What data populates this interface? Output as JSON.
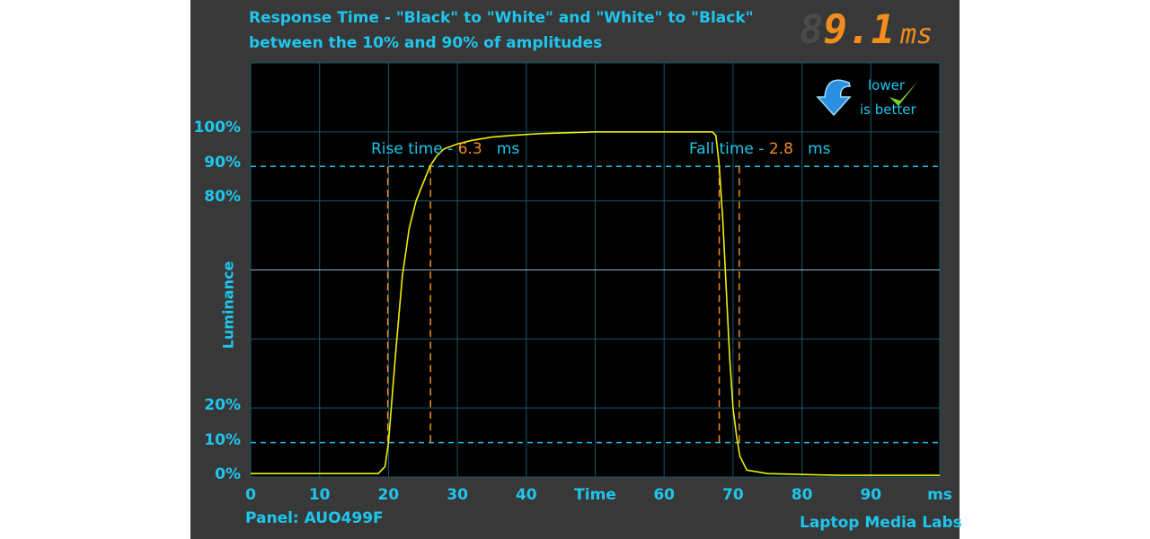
{
  "title_line1": "Response Time - \"Black\" to \"White\" and \"White\" to \"Black\"",
  "title_line2": "between the 10% and 90% of amplitudes",
  "readout": {
    "value": "9.1",
    "unit": "ms",
    "ghost": "8"
  },
  "badge": {
    "line1": "lower",
    "line2": "is better",
    "icons": [
      "arrow-down-curved-icon",
      "checkmark-icon"
    ]
  },
  "panel_label": "Panel: AUO499F",
  "brand": "Laptop Media Labs",
  "colors": {
    "background": "#383838",
    "plot": "#000000",
    "grid": "#0f5a6e",
    "text": "#1ec6ee",
    "signal": "#f0f000",
    "marker": "#f28c1c"
  },
  "chart_data": {
    "type": "line",
    "xlabel": "Time",
    "x_unit": "ms",
    "ylabel": "Luminance",
    "xlim": [
      0,
      100
    ],
    "ylim": [
      0,
      120
    ],
    "x_ticks": [
      "0",
      "10",
      "20",
      "30",
      "40",
      "Time",
      "60",
      "70",
      "80",
      "90",
      "ms"
    ],
    "y_ticks": [
      {
        "value": 0,
        "label": "0%"
      },
      {
        "value": 10,
        "label": "10%"
      },
      {
        "value": 20,
        "label": "20%"
      },
      {
        "value": 80,
        "label": "80%"
      },
      {
        "value": 90,
        "label": "90%"
      },
      {
        "value": 100,
        "label": "100%"
      }
    ],
    "threshold_lines": [
      10,
      90
    ],
    "grid": true,
    "series": [
      {
        "x": [
          0,
          18.5,
          19.5,
          20,
          21,
          22,
          23,
          24,
          25,
          26,
          27,
          28,
          30,
          32,
          35,
          38,
          42,
          50,
          60,
          67,
          67.5,
          67.8,
          68,
          68.5,
          69,
          69.5,
          70,
          70.5,
          71,
          72,
          75,
          85,
          100
        ],
        "y": [
          1,
          1,
          3,
          10,
          35,
          58,
          72,
          80,
          85,
          90,
          93,
          95,
          96.5,
          97.5,
          98.5,
          99,
          99.5,
          100,
          100,
          100,
          99,
          94,
          90,
          75,
          55,
          35,
          20,
          12,
          6,
          2,
          1,
          0.5,
          0.5
        ]
      }
    ],
    "annotations": {
      "rise": {
        "label": "Rise time - ",
        "value": "6.3",
        "unit": "ms",
        "start": 19.9,
        "end": 26.1
      },
      "fall": {
        "label": "Fall time - ",
        "value": "2.8",
        "unit": "ms",
        "start": 68.0,
        "end": 70.9
      }
    }
  }
}
